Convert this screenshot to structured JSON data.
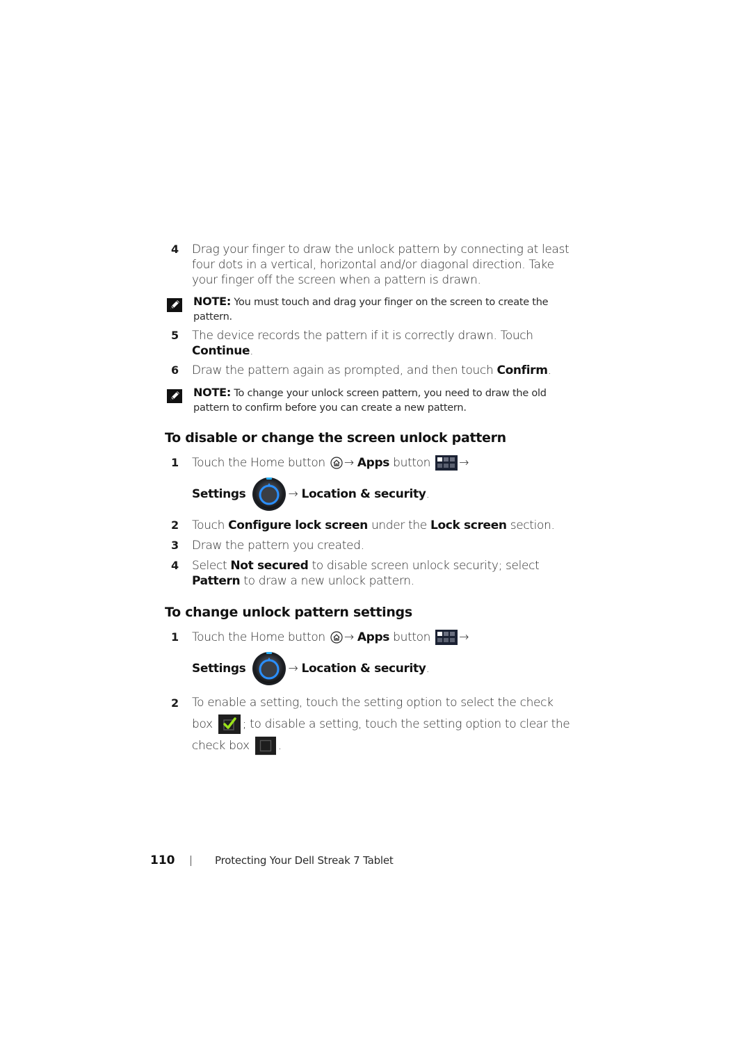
{
  "steps_top": [
    {
      "num": "4",
      "text": "Drag your finger to draw the unlock pattern by connecting at least four dots in a vertical, horizontal and/or diagonal direction. Take your finger off the screen when a pattern is drawn."
    },
    {
      "num": "5",
      "text_a": "The device records the pattern if it is correctly drawn. Touch ",
      "bold": "Continue",
      "text_b": "."
    },
    {
      "num": "6",
      "text_a": "Draw the pattern again as prompted, and then touch ",
      "bold": "Confirm",
      "text_b": "."
    }
  ],
  "notes": [
    {
      "label": "NOTE:",
      "text": " You must touch and drag your finger on the screen to create the pattern.",
      "icon": "note-pencil-icon"
    },
    {
      "label": "NOTE:",
      "text": " To change your unlock screen pattern, you need to draw the old pattern to confirm before you can create a new pattern.",
      "icon": "note-pencil-icon"
    }
  ],
  "section_disable": {
    "heading": "To disable or change the screen unlock pattern",
    "step1": {
      "num": "1",
      "text_a": "Touch the Home button ",
      "arrow": "→",
      "apps": "Apps",
      "button_word": " button ",
      "settings": "Settings",
      "location": "Location & security",
      "period": "."
    },
    "step2": {
      "num": "2",
      "text_a": "Touch ",
      "bold_a": "Configure lock screen",
      "text_b": " under the ",
      "bold_b": "Lock screen",
      "text_c": " section."
    },
    "step3": {
      "num": "3",
      "text": "Draw the pattern you created."
    },
    "step4": {
      "num": "4",
      "text_a": "Select ",
      "bold_a": "Not secured",
      "text_b": " to disable screen unlock security; select ",
      "bold_b": "Pattern",
      "text_c": " to draw a new unlock pattern."
    }
  },
  "section_change": {
    "heading": "To change unlock pattern settings",
    "step1": {
      "num": "1",
      "text_a": "Touch the Home button ",
      "arrow": "→",
      "apps": "Apps",
      "button_word": " button ",
      "settings": "Settings",
      "location": "Location & security",
      "period": "."
    },
    "step2": {
      "num": "2",
      "text_a": "To enable a setting, touch the setting option to select the check box ",
      "text_b": "; to disable a setting, touch the setting option to clear the check box ",
      "text_c": "."
    }
  },
  "footer": {
    "page_number": "110",
    "title": "Protecting Your Dell Streak 7 Tablet"
  },
  "colors": {
    "text": "#2b2b2b",
    "accent_blue": "#2a8fff",
    "check_green": "#9be21a",
    "icon_dark": "#1e1e1e"
  }
}
